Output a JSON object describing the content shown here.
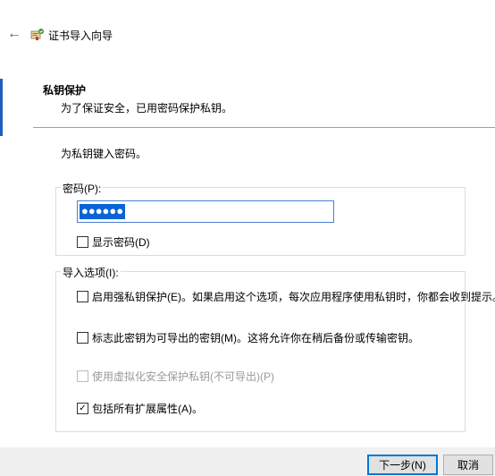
{
  "window": {
    "title": "证书导入向导",
    "back_icon": "arrow-left-icon",
    "wizard_icon": "certificate-wizard-icon"
  },
  "header": {
    "title": "私钥保护",
    "subtitle": "为了保证安全，已用密码保护私钥。"
  },
  "main": {
    "instruction": "为私钥键入密码。",
    "password_group": {
      "label": "密码(P):",
      "password_masked": "●●●●●●",
      "show_password_label": "显示密码(D)",
      "show_password_checked": false
    },
    "import_options": {
      "label": "导入选项(I):",
      "options": [
        {
          "label": "启用强私钥保护(E)。如果启用这个选项，每次应用程序使用私钥时，你都会收到提示。",
          "checked": false,
          "enabled": true,
          "mark": ""
        },
        {
          "label": "标志此密钥为可导出的密钥(M)。这将允许你在稍后备份或传输密钥。",
          "checked": false,
          "enabled": true,
          "mark": ""
        },
        {
          "label": "使用虚拟化安全保护私钥(不可导出)(P)",
          "checked": false,
          "enabled": false,
          "mark": ""
        },
        {
          "label": "包括所有扩展属性(A)。",
          "checked": true,
          "enabled": true,
          "mark": "✓"
        }
      ]
    }
  },
  "footer": {
    "next_label": "下一步(N)",
    "cancel_label": "取消"
  },
  "colors": {
    "accent": "#0078d7",
    "selection": "#0a64d6"
  }
}
